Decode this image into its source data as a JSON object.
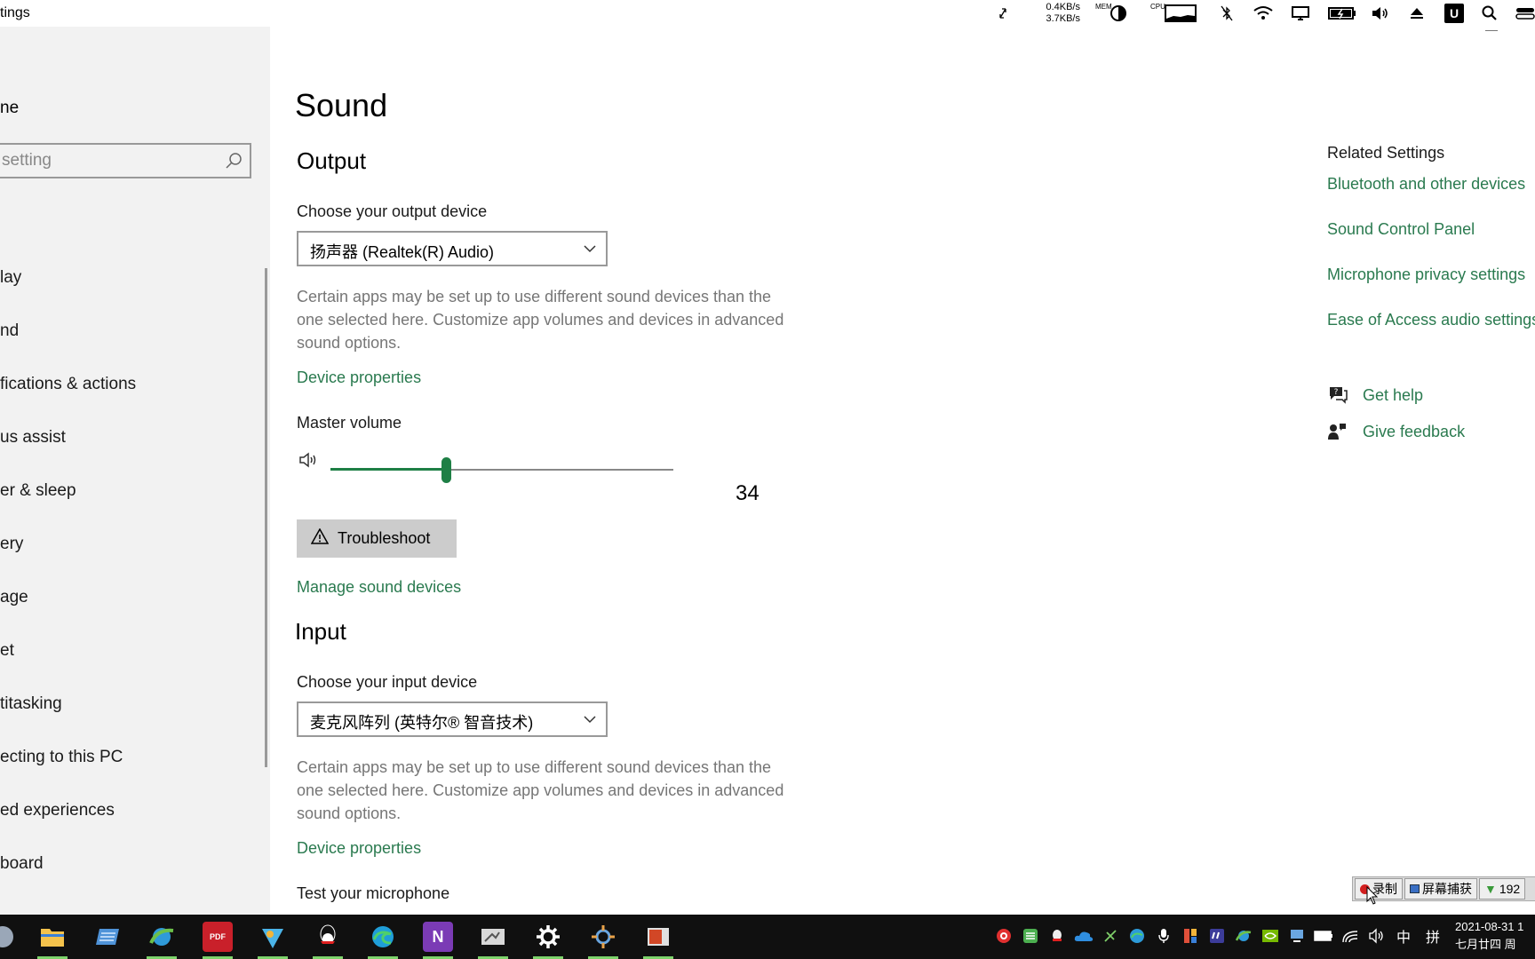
{
  "window": {
    "title": "tings"
  },
  "system_tray_top": {
    "net_up": "0.4KB/s",
    "net_down": "3.7KB/s",
    "mem_label": "MEM",
    "cpu_label": "CPU",
    "icons": [
      "refresh-arrows-icon",
      "pie-chart-icon",
      "cpu-graph-icon",
      "no-bluetooth-icon",
      "wifi-icon",
      "monitor-icon",
      "battery-icon",
      "speaker-icon",
      "eject-icon",
      "u-app-icon",
      "search-icon",
      "toggle-icon"
    ],
    "u_label": "U"
  },
  "sidebar": {
    "home_label": "ne",
    "search_placeholder": "setting",
    "items": [
      {
        "label": "lay"
      },
      {
        "label": "nd"
      },
      {
        "label": "fications & actions"
      },
      {
        "label": "us assist"
      },
      {
        "label": "er & sleep"
      },
      {
        "label": "ery"
      },
      {
        "label": "age"
      },
      {
        "label": "et"
      },
      {
        "label": "titasking"
      },
      {
        "label": "ecting to this PC"
      },
      {
        "label": "ed experiences"
      },
      {
        "label": "board"
      }
    ]
  },
  "main": {
    "page_title": "Sound",
    "output": {
      "heading": "Output",
      "choose_label": "Choose your output device",
      "device_value": "扬声器 (Realtek(R) Audio)",
      "description": "Certain apps may be set up to use different sound devices than the one selected here. Customize app volumes and devices in advanced sound options.",
      "device_properties_link": "Device properties",
      "master_volume_label": "Master volume",
      "volume_value": "34",
      "volume_fraction": 0.34,
      "troubleshoot_label": "Troubleshoot",
      "manage_link": "Manage sound devices"
    },
    "input": {
      "heading": "Input",
      "choose_label": "Choose your input device",
      "device_value": "麦克风阵列 (英特尔® 智音技术)",
      "description": "Certain apps may be set up to use different sound devices than the one selected here. Customize app volumes and devices in advanced sound options.",
      "device_properties_link": "Device properties",
      "test_label": "Test your microphone"
    },
    "related": {
      "title": "Related Settings",
      "links": [
        {
          "label": "Bluetooth and other devices"
        },
        {
          "label": "Sound Control Panel"
        },
        {
          "label": "Microphone privacy settings"
        },
        {
          "label": "Ease of Access audio settings"
        }
      ],
      "get_help": "Get help",
      "give_feedback": "Give feedback"
    }
  },
  "taskbar": {
    "apps": [
      "start-icon",
      "file-explorer-icon",
      "notepad-icon",
      "ie-icon",
      "pdf-app-icon",
      "photos-icon",
      "qq-icon",
      "edge-icon",
      "onenote-icon",
      "snipping-icon",
      "settings-icon",
      "control-panel-icon",
      "powerpoint-icon"
    ],
    "onenote_letter": "N",
    "pdf_label": "PDF",
    "ime_label": "中",
    "ime2_label": "拼",
    "date": "2021-08-31 1",
    "lunar_date": "七月廿四 周"
  },
  "recorder_bar": {
    "record_label": "录制",
    "capture_label": "屏幕捕获",
    "ip_label": "192"
  },
  "colors": {
    "accent": "#1e7f45",
    "link": "#2a7a4f",
    "sidebar_bg": "#f2f2f2",
    "taskbar_bg": "#101010"
  }
}
